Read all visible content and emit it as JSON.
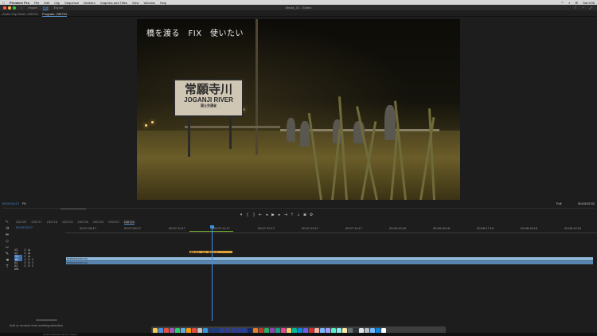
{
  "menubar": {
    "app": "Premiere Pro",
    "items": [
      "File",
      "Edit",
      "Clip",
      "Sequence",
      "Markers",
      "Graphics and Titles",
      "View",
      "Window",
      "Help"
    ],
    "clock": "Sat 9:55"
  },
  "titlebar": {
    "workspaces": [
      "Import",
      "Edit",
      "Export"
    ],
    "active_workspace": "Edit",
    "document": "Media_02 - Edited"
  },
  "panels": {
    "source": "Audio Clip Mixer: 230724",
    "program": "Program: 230724"
  },
  "program_monitor": {
    "caption": "橋を渡る　FIX　使いたい",
    "sign_main": "常願寺川",
    "sign_en": "JOGANJI RIVER",
    "sign_small": "国土交通省",
    "timecode": "00:00:03:27",
    "fit": "Fit",
    "resolution": "Full",
    "duration": "00:03:02:02"
  },
  "sequence_tabs": [
    "230720",
    "230717",
    "230718",
    "230723",
    "230705",
    "230722",
    "230723",
    "230724"
  ],
  "active_sequence": "230724",
  "timeline": {
    "playhead_tc": "00:00:03:27",
    "ruler_ticks": [
      "00:07:08:17",
      "00:07:09:17",
      "00:07:10:17",
      "00:07:11:17",
      "00:07:12:17",
      "00:07:13:17",
      "00:07:14:17",
      "00:08:15:16",
      "00:08:16:16",
      "00:08:17:16",
      "00:08:18:16",
      "00:08:19:16"
    ],
    "tracks": [
      {
        "label": "V3"
      },
      {
        "label": "V2"
      },
      {
        "label": "V1"
      },
      {
        "label": "A1"
      },
      {
        "label": "A2"
      },
      {
        "label": "A3"
      },
      {
        "label": "Mix"
      }
    ],
    "text_clip": "橋を渡る　FIX　使いたい",
    "video_clip": "P1350126.MOV [V]",
    "audio_clip": "P1350126.MOV [A]"
  },
  "status": {
    "message": "Add or remove from existing selection"
  },
  "dock": {
    "colors": [
      "#f2c94c",
      "#4a90e2",
      "#e94e3c",
      "#9b59b6",
      "#2ecc71",
      "#5dade2",
      "#f39c12",
      "#e74c3c",
      "#bdc3c7",
      "#3498db",
      "#1f3a7a",
      "#1f3a7a",
      "#2c3e91",
      "#2c3e91",
      "#2c3e91",
      "#2c3e91",
      "#2c3e91",
      "#0f2a6b",
      "#e67e22",
      "#c0392b",
      "#27ae60",
      "#8e44ad",
      "#16a085",
      "#e84393",
      "#fdcb6e",
      "#00b894",
      "#0984e3",
      "#6c5ce7",
      "#d63031",
      "#fab1a0",
      "#74b9ff",
      "#a29bfe",
      "#55efc4",
      "#81ecec",
      "#ffeaa7",
      "#636e72",
      "#2d3436",
      "#dfe6e9",
      "#b2bec3",
      "#74b9ff",
      "#0984e3",
      "#ffffff"
    ]
  },
  "bottom": {
    "text": "Ubuntu  Windows 11 Arm Project"
  }
}
